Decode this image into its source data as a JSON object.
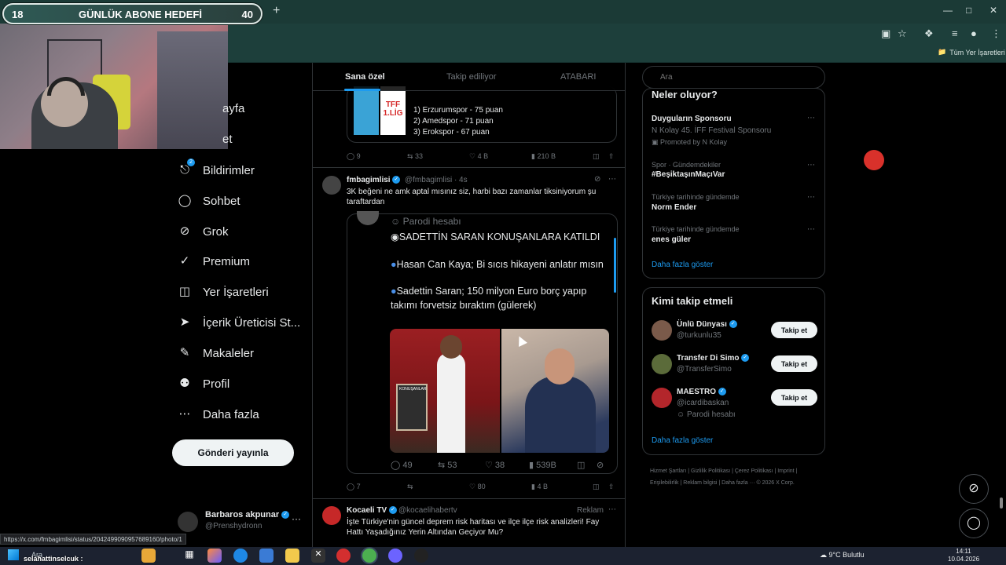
{
  "subgoal": {
    "current": "18",
    "title": "GÜNLÜK ABONE HEDEFİ",
    "target": "40"
  },
  "browser": {
    "new_tab": "+",
    "bookmarks_all": "Tüm Yer İşaretleri",
    "status_url": "https://x.com/fmbagimlisi/status/2042499090957689160/photo/1"
  },
  "nav": {
    "items": [
      {
        "label": "ayfa",
        "icon": "home-icon"
      },
      {
        "label": "et",
        "icon": "explore-icon"
      },
      {
        "label": "Bildirimler",
        "icon": "bell-icon",
        "badge": "2"
      },
      {
        "label": "Sohbet",
        "icon": "chat-icon"
      },
      {
        "label": "Grok",
        "icon": "grok-icon"
      },
      {
        "label": "Premium",
        "icon": "premium-icon"
      },
      {
        "label": "Yer İşaretleri",
        "icon": "bookmark-icon"
      },
      {
        "label": "İçerik Üreticisi St...",
        "icon": "rocket-icon"
      },
      {
        "label": "Makaleler",
        "icon": "article-icon"
      },
      {
        "label": "Profil",
        "icon": "person-icon"
      },
      {
        "label": "Daha fazla",
        "icon": "more-circle-icon"
      }
    ],
    "post_button": "Gönderi yayınla",
    "account": {
      "name": "Barbaros akpunar",
      "handle": "@Prenshydronn",
      "more": "···"
    }
  },
  "feed": {
    "tabs": [
      "Sana özel",
      "Takip ediliyor",
      "ATABARI"
    ],
    "post1": {
      "standings": [
        "1) Erzurumspor - 75 puan",
        "2) Amedspor - 71 puan",
        "3) Erokspor - 67 puan"
      ],
      "logo_text": "TFF 1.LİG",
      "actions": {
        "replies": "9",
        "reposts": "33",
        "likes": "4 B",
        "views": "210 B"
      }
    },
    "post2": {
      "name": "fmbagimlisi",
      "handle": "@fmbagimlisi · 4s",
      "text": "3K beğeni ne amk aptal mısınız siz, harbi bazı zamanlar tiksiniyorum şu taraftardan",
      "quote": {
        "parody": "Parodi hesabı",
        "lines": [
          "SADETTİN SARAN KONUŞANLARA KATILDI",
          "Hasan Can Kaya; Bi sıcıs hikayeni anlatır mısın",
          "Sadettin Saran; 150 milyon Euro borç yapıp takımı forvetsiz bıraktım (gülerek)"
        ],
        "board_text": "KONUŞANLAR",
        "actions": {
          "replies": "49",
          "reposts": "53",
          "likes": "38",
          "views": "539B"
        }
      },
      "actions": {
        "replies": "7",
        "reposts": "",
        "likes": "80",
        "views": "4 B"
      }
    },
    "post3": {
      "name": "Kocaeli TV",
      "handle": "@kocaelihabertv",
      "tag": "Reklam",
      "text": "İşte Türkiye'nin güncel deprem risk haritası ve ilçe ilçe risk analizleri! Fay Hattı Yaşadığınız Yerin Altından Geçiyor Mu?"
    }
  },
  "right": {
    "search_placeholder": "Ara",
    "trends_title": "Neler oluyor?",
    "trends": [
      {
        "meta": "",
        "name": "Duyguların Sponsoru",
        "sub": "N Kolay 45. İFF Festival Sponsoru",
        "promo": "Promoted by N Kolay"
      },
      {
        "meta": "Spor · Gündemdekiler",
        "name": "#BeşiktaşınMaçıVar"
      },
      {
        "meta": "Türkiye tarihinde gündemde",
        "name": "Norm Ender"
      },
      {
        "meta": "Türkiye tarihinde gündemde",
        "name": "enes güler"
      }
    ],
    "show_more": "Daha fazla göster",
    "who_title": "Kimi takip etmeli",
    "who": [
      {
        "name": "Ünlü Dünyası",
        "handle": "@turkunlu35",
        "extra": ""
      },
      {
        "name": "Transfer Di Simo",
        "handle": "@TransferSimo",
        "extra": ""
      },
      {
        "name": "MAESTRO",
        "handle": "@icardibaskan",
        "extra": "Parodi hesabı"
      }
    ],
    "follow_label": "Takip et",
    "who_more": "Daha fazla göster",
    "footer": "Hizmet Şartları | Gizlilik Politikası | Çerez Politikası | Imprint | Erişilebilirlik | Reklam bilgisi | Daha fazla ··· © 2026 X Corp."
  },
  "taskbar": {
    "search": "Ara",
    "chat_user": "selahattinselcuk :",
    "weather": "9°C Bulutlu",
    "time": "14:11",
    "date": "10.04.2026"
  },
  "colors": {
    "accent": "#1d9bf0",
    "background": "#000000",
    "chrome": "#1d3f3b"
  }
}
